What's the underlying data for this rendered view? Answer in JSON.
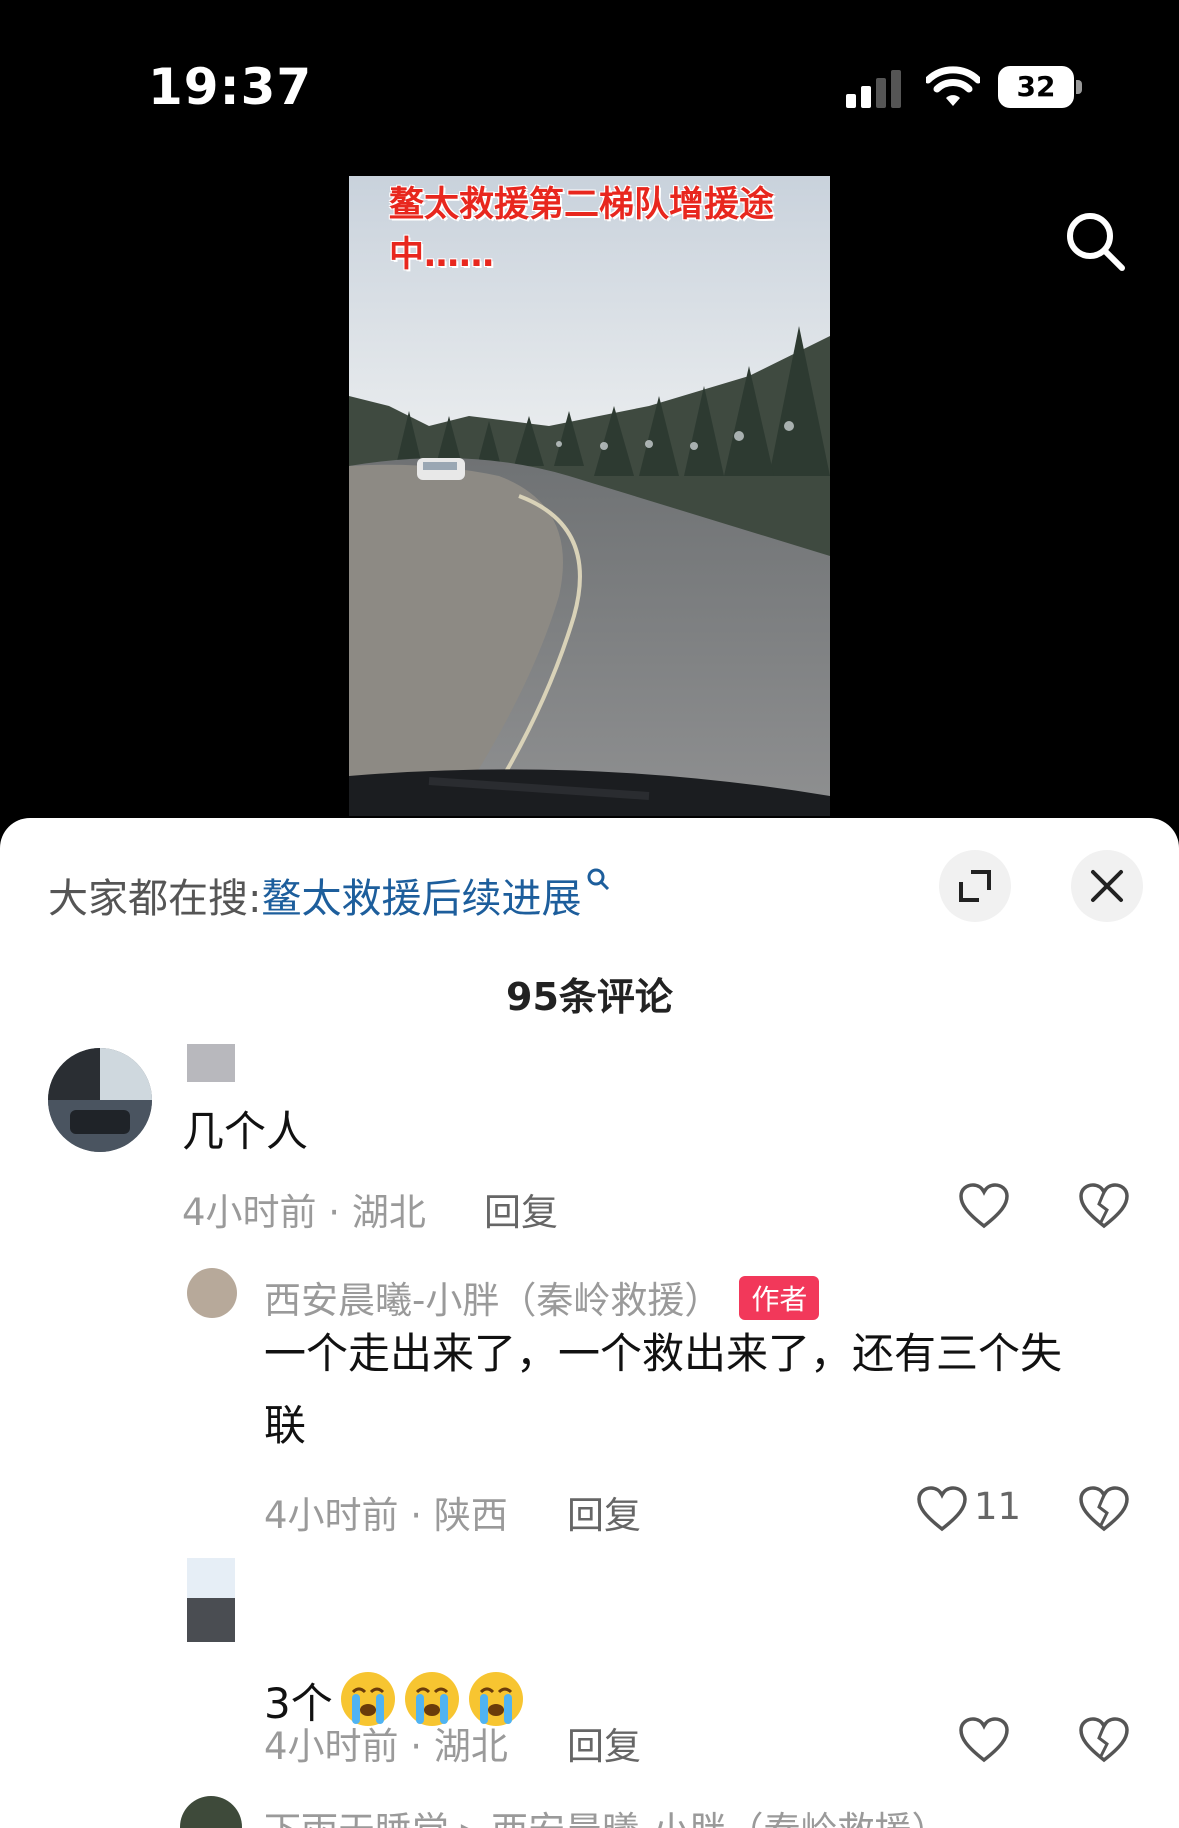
{
  "status_bar": {
    "time": "19:37",
    "battery": "32",
    "icons": [
      "signal-icon",
      "wifi-icon",
      "battery-icon"
    ]
  },
  "video": {
    "caption": "鳌太救援第二梯队增援途中……"
  },
  "sheet": {
    "search_prefix": "大家都在搜:",
    "search_term": "鳌太救援后续进展",
    "comment_count": "95条评论"
  },
  "comments": [
    {
      "text": "几个人",
      "time_loc": "4小时前 · 湖北",
      "reply": "回复",
      "likes": ""
    },
    {
      "username": "西安晨曦-小胖（秦岭救援）",
      "badge": "作者",
      "text_line1": "一个走出来了，一个救出来了，还有三个失",
      "text_line2": "联",
      "time_loc": "4小时前 · 陕西",
      "reply": "回复",
      "likes": "11"
    },
    {
      "text": "3个",
      "time_loc": "4小时前 · 湖北",
      "reply": "回复",
      "likes": ""
    },
    {
      "username": "下雨天睡觉 ▸ 西安晨曦-小胖（秦岭救援）"
    }
  ],
  "colors": {
    "search_term": "#1d5e9c",
    "author_badge": "#f2385a",
    "meta_text": "#9a9a9a"
  }
}
